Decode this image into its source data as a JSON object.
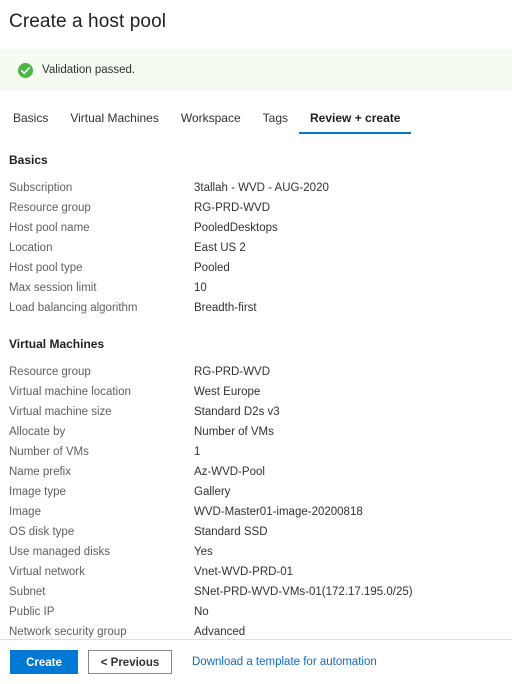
{
  "page": {
    "title": "Create a host pool"
  },
  "banner": {
    "icon": "check-circle-icon",
    "message": "Validation passed.",
    "accent_color": "#4bb543",
    "background_color": "#f4fcf2"
  },
  "tabs": [
    {
      "label": "Basics",
      "active": false
    },
    {
      "label": "Virtual Machines",
      "active": false
    },
    {
      "label": "Workspace",
      "active": false
    },
    {
      "label": "Tags",
      "active": false
    },
    {
      "label": "Review + create",
      "active": true
    }
  ],
  "sections": [
    {
      "title": "Basics",
      "rows": [
        {
          "label": "Subscription",
          "value": "3tallah - WVD - AUG-2020"
        },
        {
          "label": "Resource group",
          "value": "RG-PRD-WVD"
        },
        {
          "label": "Host pool name",
          "value": "PooledDesktops"
        },
        {
          "label": "Location",
          "value": "East US 2"
        },
        {
          "label": "Host pool type",
          "value": "Pooled"
        },
        {
          "label": "Max session limit",
          "value": "10"
        },
        {
          "label": "Load balancing algorithm",
          "value": "Breadth-first"
        }
      ]
    },
    {
      "title": "Virtual Machines",
      "rows": [
        {
          "label": "Resource group",
          "value": "RG-PRD-WVD"
        },
        {
          "label": "Virtual machine location",
          "value": "West Europe"
        },
        {
          "label": "Virtual machine size",
          "value": "Standard D2s v3"
        },
        {
          "label": "Allocate by",
          "value": "Number of VMs"
        },
        {
          "label": "Number of VMs",
          "value": "1"
        },
        {
          "label": "Name prefix",
          "value": "Az-WVD-Pool"
        },
        {
          "label": "Image type",
          "value": "Gallery"
        },
        {
          "label": "Image",
          "value": "WVD-Master01-image-20200818"
        },
        {
          "label": "OS disk type",
          "value": "Standard SSD"
        },
        {
          "label": "Use managed disks",
          "value": "Yes"
        },
        {
          "label": "Virtual network",
          "value": "Vnet-WVD-PRD-01"
        },
        {
          "label": "Subnet",
          "value": "SNet-PRD-WVD-VMs-01(172.17.195.0/25)"
        },
        {
          "label": "Public IP",
          "value": "No"
        },
        {
          "label": "Network security group",
          "value": "Advanced"
        }
      ]
    }
  ],
  "footer": {
    "create_label": "Create",
    "previous_label": "< Previous",
    "download_link_label": "Download a template for automation",
    "primary_color": "#0078d4",
    "link_color": "#0f6cbd"
  }
}
